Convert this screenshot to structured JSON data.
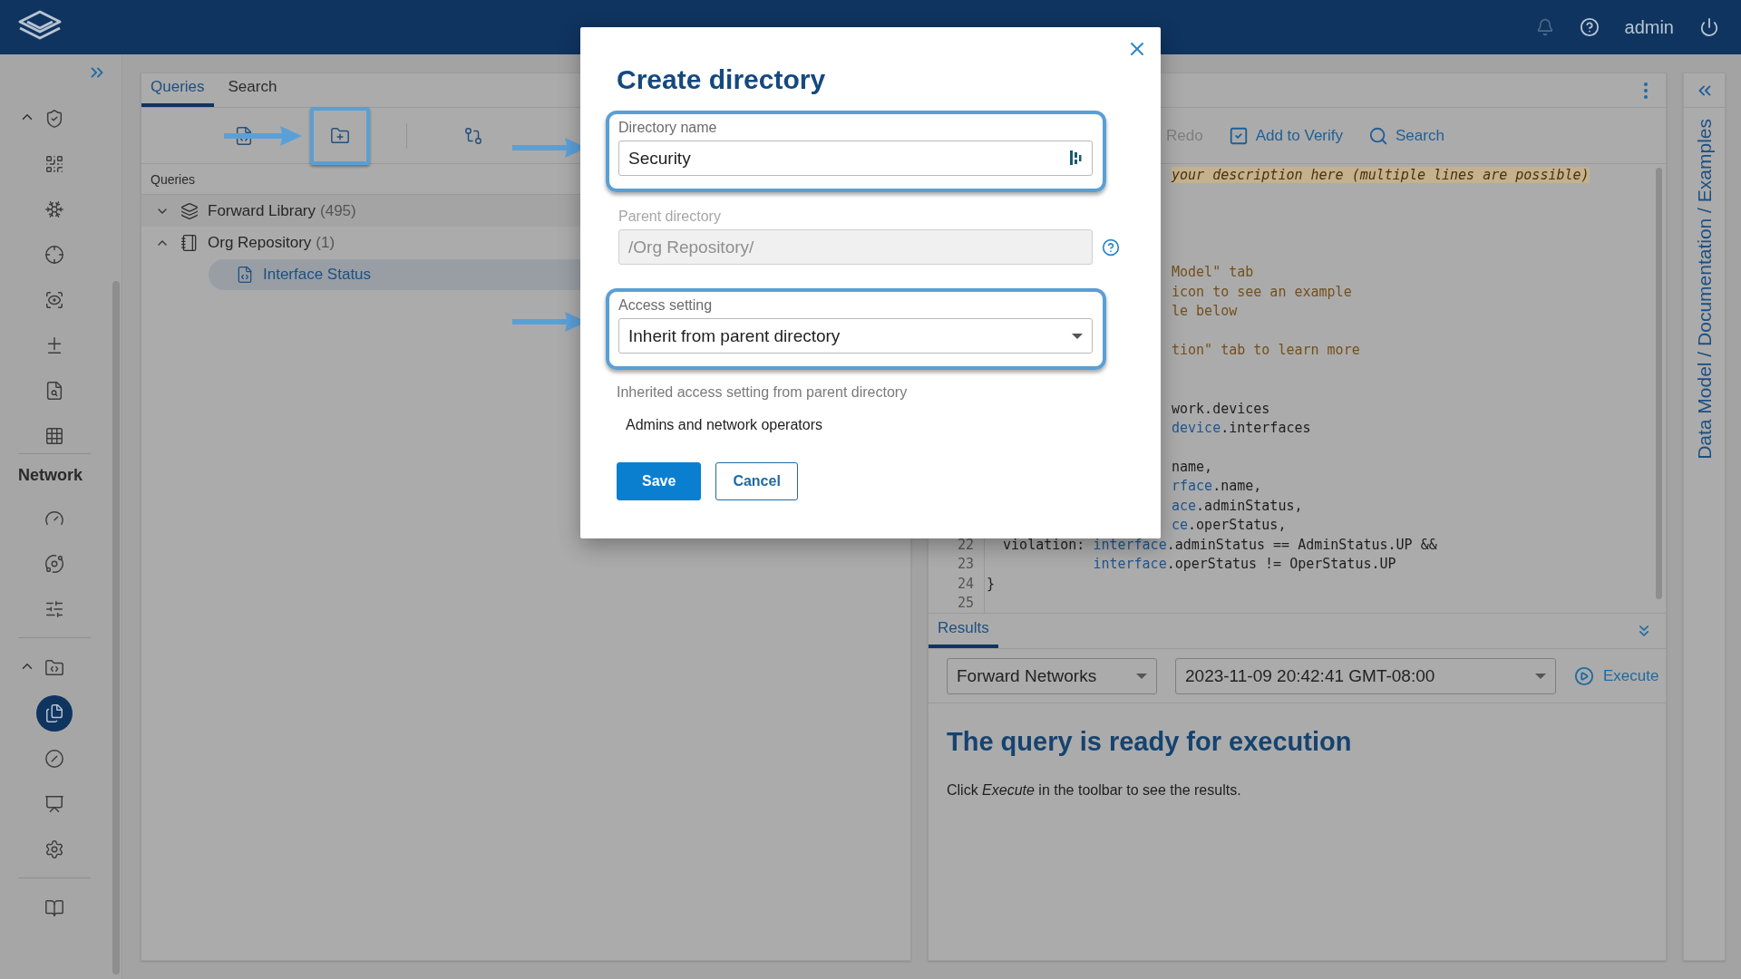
{
  "top_bar": {
    "user": "admin"
  },
  "sidebar": {
    "groups": [
      {
        "expanded": true,
        "items": [
          {
            "selected": false
          },
          {
            "selected": false
          },
          {
            "selected": false
          },
          {
            "selected": false
          },
          {
            "selected": false
          },
          {
            "selected": false
          },
          {
            "selected": false
          },
          {
            "selected": false
          }
        ]
      },
      {
        "label": "Network",
        "items": [
          {
            "selected": false
          },
          {
            "selected": false
          },
          {
            "selected": false
          }
        ]
      },
      {
        "expanded": true,
        "items": [
          {
            "selected": false
          },
          {
            "selected": true
          },
          {
            "selected": false
          },
          {
            "selected": false
          },
          {
            "selected": false
          }
        ]
      },
      {
        "items": [
          {
            "selected": false
          }
        ]
      }
    ]
  },
  "queries_panel": {
    "tabs": [
      {
        "label": "Queries",
        "selected": true
      },
      {
        "label": "Search",
        "selected": false
      }
    ],
    "toolbar": [
      {
        "highlighted": false
      },
      {
        "highlighted": true
      },
      {
        "highlighted": false
      }
    ],
    "list_header": "Queries",
    "tree": [
      {
        "kind": "library",
        "label": "Forward Library",
        "count": "(495)",
        "expanded": false
      },
      {
        "kind": "repository",
        "label": "Org Repository",
        "count": "(1)",
        "expanded": true,
        "children": [
          {
            "kind": "query",
            "label": "Interface Status",
            "selected": true
          }
        ]
      }
    ]
  },
  "editor": {
    "toolbar": [
      {
        "label": "Redo",
        "disabled": true
      },
      {
        "label": "Add to Verify",
        "disabled": false
      },
      {
        "label": "Search",
        "disabled": false
      }
    ],
    "lines": [
      {
        "kind": "partial",
        "segments": [
          {
            "text": "your description here (multiple lines are possible)",
            "kind": "highlight"
          }
        ]
      },
      {
        "kind": "blank"
      },
      {
        "kind": "blank"
      },
      {
        "kind": "blank"
      },
      {
        "kind": "blank"
      },
      {
        "kind": "partial",
        "segments": [
          {
            "text": "Model\" tab",
            "kind": "comment"
          }
        ]
      },
      {
        "kind": "partial",
        "segments": [
          {
            "text": "icon to see an example",
            "kind": "comment"
          }
        ]
      },
      {
        "kind": "partial",
        "segments": [
          {
            "text": "le below",
            "kind": "comment"
          }
        ]
      },
      {
        "kind": "blank"
      },
      {
        "kind": "partial",
        "segments": [
          {
            "text": "tion\" tab to learn more",
            "kind": "comment"
          }
        ]
      },
      {
        "kind": "blank"
      },
      {
        "kind": "blank"
      },
      {
        "kind": "partial",
        "segments": [
          {
            "text": "work.devices",
            "kind": "plain"
          }
        ]
      },
      {
        "kind": "partial",
        "segments": [
          {
            "text": "device",
            "kind": "variable"
          },
          {
            "text": ".interfaces",
            "kind": "plain"
          }
        ]
      },
      {
        "kind": "blank"
      },
      {
        "kind": "partial",
        "segments": [
          {
            "text": "name,",
            "kind": "plain"
          }
        ]
      },
      {
        "kind": "partial",
        "segments": [
          {
            "text": "rface",
            "kind": "variable"
          },
          {
            "text": ".name,",
            "kind": "plain"
          }
        ]
      },
      {
        "kind": "partial",
        "segments": [
          {
            "text": "ace",
            "kind": "variable"
          },
          {
            "text": ".adminStatus,",
            "kind": "plain"
          }
        ]
      },
      {
        "kind": "partial",
        "segments": [
          {
            "text": "ce",
            "kind": "variable"
          },
          {
            "text": ".operStatus,",
            "kind": "plain"
          }
        ]
      },
      {
        "kind": "nested",
        "number": "22",
        "segments": [
          {
            "text": "violation: ",
            "kind": "plain"
          },
          {
            "text": "interface",
            "kind": "variable"
          },
          {
            "text": ".adminStatus == AdminStatus.UP &&",
            "kind": "plain"
          }
        ]
      },
      {
        "kind": "continuation",
        "number": "23",
        "segments": [
          {
            "text": "interface",
            "kind": "variable"
          },
          {
            "text": ".operStatus != OperStatus.UP",
            "kind": "plain"
          }
        ]
      },
      {
        "kind": "code",
        "number": "24",
        "segments": [
          {
            "text": "}",
            "kind": "plain"
          }
        ]
      },
      {
        "kind": "code",
        "number": "25"
      }
    ]
  },
  "results": {
    "tabs": [
      {
        "label": "Results",
        "selected": true
      }
    ],
    "network": "Forward Networks",
    "snapshot": "2023-11-09 20:42:41 GMT-08:00",
    "execute": "Execute",
    "heading": "The query is ready for execution",
    "message": "Click *Execute* in the toolbar to see the results."
  },
  "side_panel": {
    "title": "Data Model / Documentation / Examples"
  },
  "dialog": {
    "title": "Create directory",
    "fields": [
      {
        "kind": "text",
        "label": "Directory name",
        "value": "Security",
        "disabled": false,
        "highlighted": true,
        "help": false
      },
      {
        "kind": "text",
        "label": "Parent directory",
        "value": "/Org Repository/",
        "disabled": true,
        "highlighted": false,
        "help": true
      },
      {
        "kind": "select",
        "label": "Access setting",
        "value": "Inherit from parent directory",
        "disabled": false,
        "highlighted": true,
        "help": false
      }
    ],
    "inherited_label": "Inherited access setting from parent directory",
    "inherited_value": "Admins and network operators",
    "buttons": [
      {
        "label": "Save",
        "primary": true
      },
      {
        "label": "Cancel",
        "primary": false
      }
    ]
  }
}
